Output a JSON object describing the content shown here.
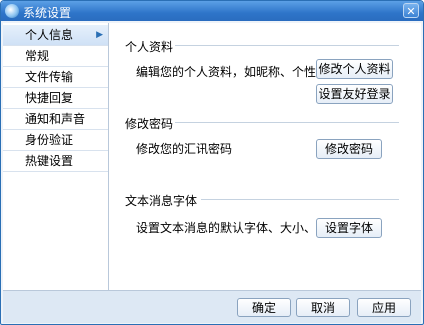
{
  "window": {
    "title": "系统设置",
    "close_glyph": "✕"
  },
  "sidebar": {
    "items": [
      {
        "label": "个人信息",
        "active": true
      },
      {
        "label": "常规"
      },
      {
        "label": "文件传输"
      },
      {
        "label": "快捷回复"
      },
      {
        "label": "通知和声音"
      },
      {
        "label": "身份验证"
      },
      {
        "label": "热键设置"
      }
    ],
    "active_arrow": "▶"
  },
  "sections": {
    "profile": {
      "heading": "个人资料",
      "description": "编辑您的个人资料，如昵称、个性签名等",
      "edit_button": "修改个人资料",
      "friendly_login_button": "设置友好登录"
    },
    "password": {
      "heading": "修改密码",
      "description": "修改您的汇讯密码",
      "button": "修改密码"
    },
    "font": {
      "heading": "文本消息字体",
      "description": "设置文本消息的默认字体、大小、颜色等",
      "button": "设置字体"
    }
  },
  "footer": {
    "ok": "确定",
    "cancel": "取消",
    "apply": "应用"
  },
  "colors": {
    "title_bar": "#2e75c9",
    "border": "#2a6fb5",
    "footer_bg": "#dde8f4"
  },
  "icons": {
    "title": "app-logo-icon",
    "close": "close-icon",
    "active_item": "chevron-right-icon"
  }
}
